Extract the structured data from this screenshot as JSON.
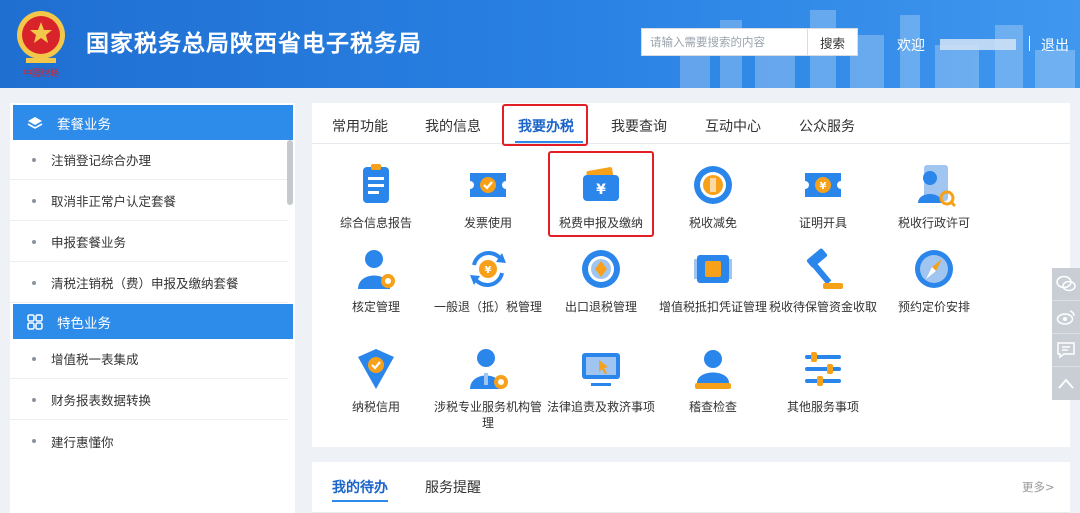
{
  "header": {
    "title": "国家税务总局陕西省电子税务局",
    "search_placeholder": "请输入需要搜索的内容",
    "search_button": "搜索",
    "welcome": "欢迎",
    "logout": "退出",
    "emblem_text": "中國稅務"
  },
  "sidebar": {
    "groups": [
      {
        "title": "套餐业务",
        "icon": "stack-icon",
        "items": [
          "注销登记综合办理",
          "取消非正常户认定套餐",
          "申报套餐业务",
          "清税注销税（费）申报及缴纳套餐"
        ]
      },
      {
        "title": "特色业务",
        "icon": "grid-icon",
        "items": [
          "增值税一表集成",
          "财务报表数据转换",
          "建行惠懂你"
        ]
      }
    ]
  },
  "main": {
    "tabs": [
      "常用功能",
      "我的信息",
      "我要办税",
      "我要查询",
      "互动中心",
      "公众服务"
    ],
    "active_tab": "我要办税",
    "tiles": [
      {
        "label": "综合信息报告",
        "icon": "report-document-icon"
      },
      {
        "label": "发票使用",
        "icon": "invoice-ticket-icon"
      },
      {
        "label": "税费申报及缴纳",
        "icon": "wallet-yuan-icon"
      },
      {
        "label": "税收减免",
        "icon": "coin-reduction-icon"
      },
      {
        "label": "证明开具",
        "icon": "certificate-yuan-icon"
      },
      {
        "label": "税收行政许可",
        "icon": "license-person-icon"
      },
      {
        "label": "核定管理",
        "icon": "user-settings-icon"
      },
      {
        "label": "一般退（抵）税管理",
        "icon": "refund-cycle-icon"
      },
      {
        "label": "出口退税管理",
        "icon": "globe-export-icon"
      },
      {
        "label": "增值税抵扣凭证管理",
        "icon": "vat-voucher-icon"
      },
      {
        "label": "税收待保管资金收取",
        "icon": "gavel-icon"
      },
      {
        "label": "预约定价安排",
        "icon": "compass-icon"
      },
      {
        "label": "纳税信用",
        "icon": "credit-shield-icon"
      },
      {
        "label": "涉税专业服务机构管理",
        "icon": "agent-settings-icon"
      },
      {
        "label": "法律追责及救济事项",
        "icon": "monitor-cursor-icon"
      },
      {
        "label": "稽查检查",
        "icon": "inspector-person-icon"
      },
      {
        "label": "其他服务事项",
        "icon": "sliders-icon"
      }
    ]
  },
  "todo": {
    "tabs": [
      "我的待办",
      "服务提醒"
    ],
    "more": "更多>"
  },
  "colors": {
    "header_blue": "#2a82e4",
    "accent_blue": "#2d8bea",
    "highlight_red": "#e31e24",
    "icon_blue": "#2a86ea",
    "icon_orange": "#f7a11a"
  }
}
